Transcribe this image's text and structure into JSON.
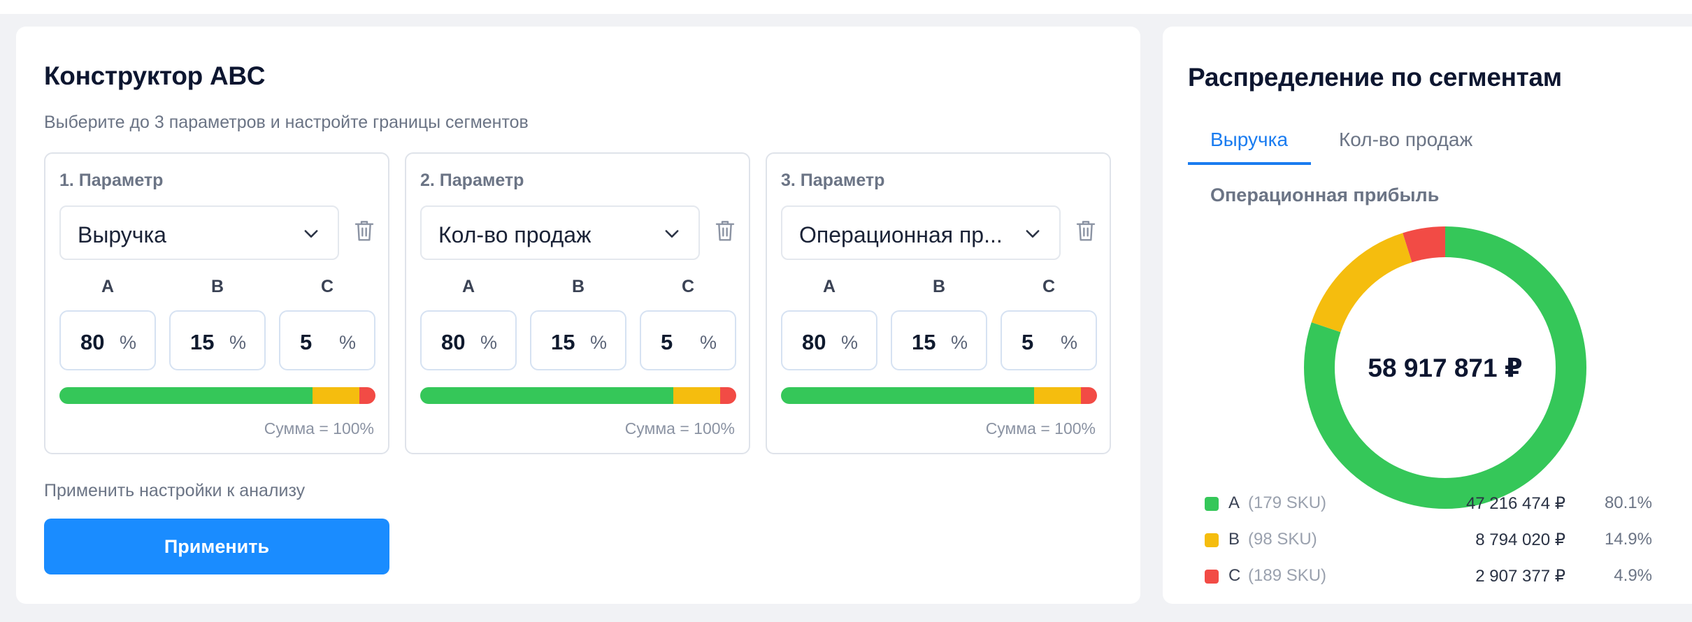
{
  "constructor": {
    "title": "Конструктор ABC",
    "subtitle": "Выберите до 3 параметров и настройте границы сегментов",
    "sum_label": "Сумма = 100%",
    "apply_label": "Применить настройки к анализу",
    "apply_button": "Применить",
    "params": [
      {
        "label": "1. Параметр",
        "value": "Выручка",
        "segments": [
          {
            "letter": "A",
            "value": "80",
            "unit": "%"
          },
          {
            "letter": "B",
            "value": "15",
            "unit": "%"
          },
          {
            "letter": "C",
            "value": "5",
            "unit": "%"
          }
        ]
      },
      {
        "label": "2. Параметр",
        "value": "Кол-во продаж",
        "segments": [
          {
            "letter": "A",
            "value": "80",
            "unit": "%"
          },
          {
            "letter": "B",
            "value": "15",
            "unit": "%"
          },
          {
            "letter": "C",
            "value": "5",
            "unit": "%"
          }
        ]
      },
      {
        "label": "3. Параметр",
        "value": "Операционная пр...",
        "segments": [
          {
            "letter": "A",
            "value": "80",
            "unit": "%"
          },
          {
            "letter": "B",
            "value": "15",
            "unit": "%"
          },
          {
            "letter": "C",
            "value": "5",
            "unit": "%"
          }
        ]
      }
    ]
  },
  "distribution": {
    "title": "Распределение по сегментам",
    "tabs": [
      {
        "label": "Выручка",
        "active": true
      },
      {
        "label": "Кол-во продаж",
        "active": false
      }
    ],
    "metric": "Операционная прибыль",
    "total": "58 917 871 ₽",
    "legend": [
      {
        "letter": "A",
        "sku": "(179 SKU)",
        "amount": "47 216 474 ₽",
        "pct": "80.1%",
        "color": "#35c759"
      },
      {
        "letter": "B",
        "sku": "(98 SKU)",
        "amount": "8 794 020 ₽",
        "pct": "14.9%",
        "color": "#f5bd0e"
      },
      {
        "letter": "C",
        "sku": "(189 SKU)",
        "amount": "2 907 377 ₽",
        "pct": "4.9%",
        "color": "#f24b45"
      }
    ]
  },
  "colors": {
    "accent": "#1a8cff",
    "segment_a": "#35c759",
    "segment_b": "#f5bd0e",
    "segment_c": "#f24b45"
  }
}
